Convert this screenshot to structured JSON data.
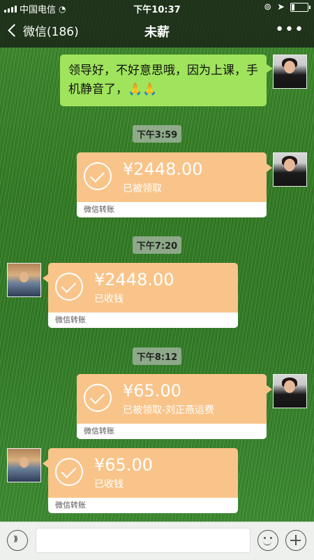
{
  "status_bar": {
    "carrier": "中国电信",
    "time": "下午10:37",
    "battery_level_percent": 20
  },
  "nav": {
    "back_label": "微信(186)",
    "title": "未薪",
    "more_icon": "more-icon"
  },
  "messages": [
    {
      "type": "text",
      "side": "right",
      "text": "领导好，不好意思哦，因为上课，手机静音了，🙏🙏"
    },
    {
      "type": "time",
      "text": "下午3:59"
    },
    {
      "type": "transfer",
      "side": "right",
      "amount": "¥2448.00",
      "status": "已被领取",
      "footer": "微信转账"
    },
    {
      "type": "time",
      "text": "下午7:20"
    },
    {
      "type": "transfer",
      "side": "left",
      "amount": "¥2448.00",
      "status": "已收钱",
      "footer": "微信转账"
    },
    {
      "type": "time",
      "text": "下午8:12"
    },
    {
      "type": "transfer",
      "side": "right",
      "amount": "¥65.00",
      "status": "已被领取-刘正燕运费",
      "footer": "微信转账"
    },
    {
      "type": "transfer",
      "side": "left",
      "amount": "¥65.00",
      "status": "已收钱",
      "footer": "微信转账"
    }
  ],
  "input_bar": {
    "voice_icon": "voice-icon",
    "emoji_icon": "emoji-icon",
    "plus_icon": "plus-icon",
    "input_value": ""
  },
  "colors": {
    "text_bubble": "#9fe45c",
    "transfer_bubble": "#f9c48a"
  }
}
